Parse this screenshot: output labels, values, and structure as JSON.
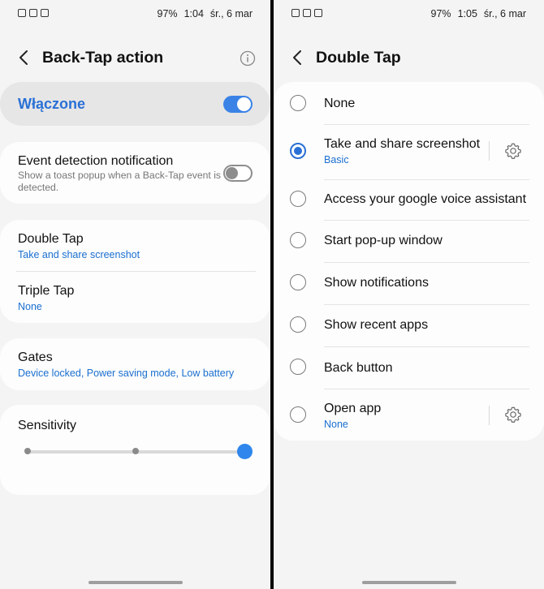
{
  "status_left": {
    "battery": "97%",
    "time": "1:04",
    "date": "śr., 6 mar"
  },
  "status_right": {
    "battery": "97%",
    "time": "1:05",
    "date": "śr., 6 mar"
  },
  "left_screen": {
    "title": "Back-Tap action",
    "master_toggle": {
      "label": "Włączone",
      "enabled": true
    },
    "event_detection": {
      "title": "Event detection notification",
      "description": "Show a toast popup when a Back-Tap event is detected.",
      "enabled": false
    },
    "double_tap": {
      "title": "Double Tap",
      "value": "Take and share screenshot"
    },
    "triple_tap": {
      "title": "Triple Tap",
      "value": "None"
    },
    "gates": {
      "title": "Gates",
      "value": "Device locked, Power saving mode, Low battery"
    },
    "sensitivity": {
      "title": "Sensitivity",
      "level": 2,
      "max_level": 2
    }
  },
  "right_screen": {
    "title": "Double Tap",
    "options": [
      {
        "label": "None",
        "selected": false
      },
      {
        "label": "Take and share screenshot",
        "sub": "Basic",
        "selected": true,
        "has_settings": true
      },
      {
        "label": "Access your google voice assistant",
        "selected": false
      },
      {
        "label": "Start pop-up window",
        "selected": false
      },
      {
        "label": "Show notifications",
        "selected": false
      },
      {
        "label": "Show recent apps",
        "selected": false
      },
      {
        "label": "Back button",
        "selected": false
      },
      {
        "label": "Open app",
        "sub": "None",
        "selected": false,
        "has_settings": true
      }
    ]
  },
  "colors": {
    "accent": "#2a70d6",
    "toggle_on": "#3a82e6",
    "background": "#f4f4f4",
    "card": "#fdfdfd"
  }
}
